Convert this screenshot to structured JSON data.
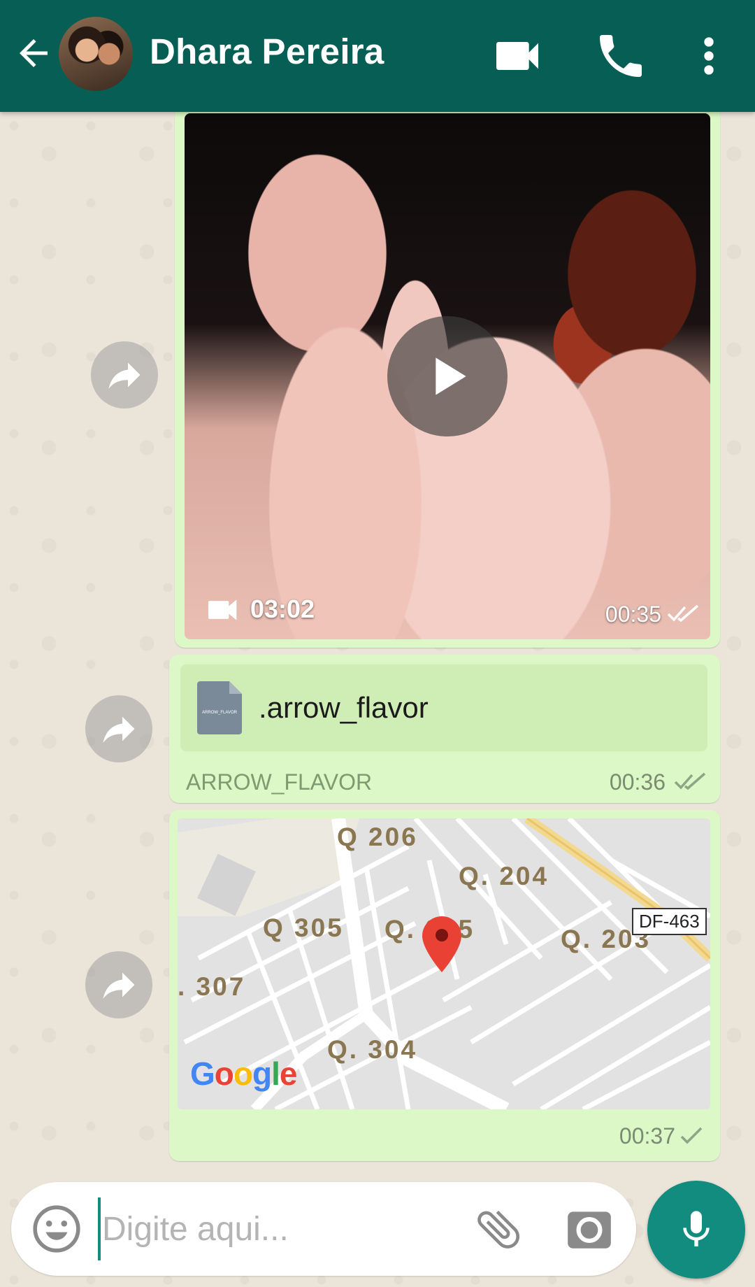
{
  "header": {
    "contact_name": "Dhara Pereira",
    "back_icon": "arrow-back-icon",
    "video_call_icon": "video-camera-icon",
    "voice_call_icon": "phone-icon",
    "menu_icon": "more-vert-icon",
    "background_color": "#075e54"
  },
  "messages": [
    {
      "type": "video",
      "duration": "03:02",
      "time": "00:35",
      "status": "read"
    },
    {
      "type": "document",
      "file_name": ".arrow_flavor",
      "file_type": "ARROW_FLAVOR",
      "thumbnail_text": "ARROW_FLAVOR",
      "time": "00:36",
      "status": "read"
    },
    {
      "type": "location",
      "map_labels": [
        "Q 206",
        "Q. 204",
        "Q 305",
        "Q. 205",
        "Q. 203",
        ". 307",
        "Q. 304"
      ],
      "road_sign": "DF-463",
      "map_provider_logo": "Google",
      "time": "00:37",
      "status": "sent"
    }
  ],
  "composer": {
    "placeholder": "Digite aqui...",
    "emoji_icon": "emoji-icon",
    "attach_icon": "paperclip-icon",
    "camera_icon": "camera-icon",
    "mic_icon": "microphone-icon"
  },
  "colors": {
    "outgoing_bubble": "#dcf8c6",
    "accent": "#128c7e",
    "read_ticks": "#ffffff"
  }
}
